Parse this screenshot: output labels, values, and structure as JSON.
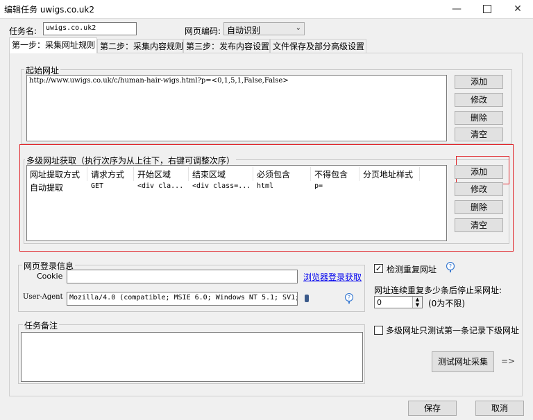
{
  "window": {
    "title": "编辑任务 uwigs.co.uk2",
    "minimize_icon": "minimize-icon",
    "maximize_icon": "maximize-icon",
    "close_icon": "close-icon"
  },
  "task": {
    "name_label": "任务名:",
    "name_value": "uwigs.co.uk2",
    "encoding_label": "网页编码:",
    "encoding_value": "自动识别"
  },
  "tabs": [
    {
      "label": "第一步：采集网址规则",
      "active": true
    },
    {
      "label": "第二步：采集内容规则",
      "active": false
    },
    {
      "label": "第三步：发布内容设置",
      "active": false
    },
    {
      "label": "文件保存及部分高级设置",
      "active": false
    }
  ],
  "start_urls": {
    "group_label": "起始网址",
    "value": "http://www.uwigs.co.uk/c/human-hair-wigs.html?p=<0,1,5,1,False,False>",
    "buttons": {
      "add": "添加",
      "edit": "修改",
      "delete": "删除",
      "clear": "清空"
    }
  },
  "multi_level": {
    "group_label": "多级网址获取（执行次序为从上往下，右键可调整次序）",
    "columns": [
      "网址提取方式",
      "请求方式",
      "开始区域",
      "结束区域",
      "必须包含",
      "不得包含",
      "分页地址样式"
    ],
    "rows": [
      [
        "自动提取",
        "GET",
        "<div cla...",
        "<div class=...",
        "html",
        "p=",
        ""
      ]
    ],
    "buttons": {
      "add": "添加",
      "edit": "修改",
      "delete": "删除",
      "clear": "清空"
    },
    "highlight_color": "#e0262b"
  },
  "login": {
    "group_label": "网页登录信息",
    "cookie_label": "Cookie",
    "cookie_value": "",
    "browser_login_link": "浏览器登录获取",
    "useragent_label": "User-Agent",
    "useragent_value": "Mozilla/4.0 (compatible; MSIE 6.0; Windows NT 5.1; SV1; .",
    "dropdown_icon": "dropdown-marker-icon",
    "help_icon": "help-icon"
  },
  "options": {
    "check_duplicate_label": "检测重复网址",
    "check_duplicate_checked": true,
    "stop_label": "网址连续重复多少条后停止采网址:",
    "stop_value": "0",
    "stop_hint": "(0为不限)",
    "test_first_label": "多级网址只测试第一条记录下级网址",
    "test_first_checked": false,
    "test_button": "测试网址采集",
    "arrow_text": "=>"
  },
  "notes": {
    "group_label": "任务备注",
    "value": ""
  },
  "footer": {
    "save": "保存",
    "cancel": "取消"
  }
}
